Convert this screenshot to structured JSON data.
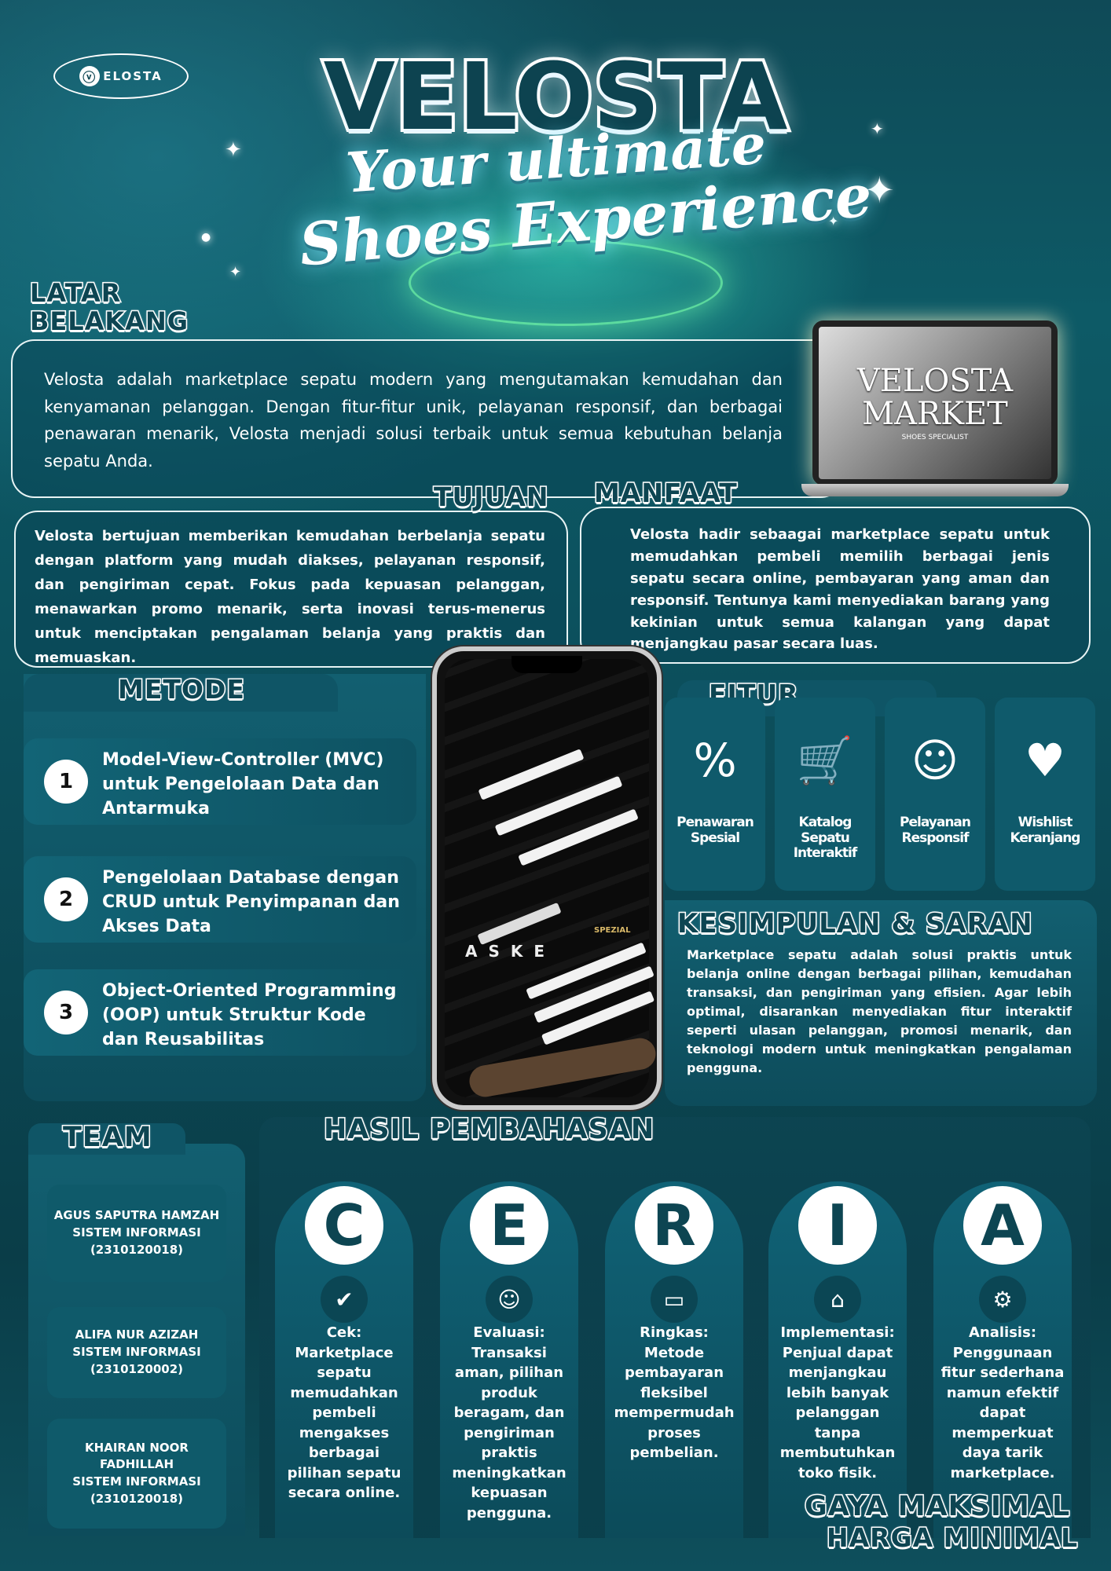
{
  "logo": {
    "icon": "footprint-icon",
    "text": "ELOSTA"
  },
  "hero": {
    "title": "VELOSTA",
    "line1": "Your ultimate",
    "line2": "Shoes Experience"
  },
  "latar": {
    "heading1": "LATAR",
    "heading2": "BELAKANG",
    "text": "Velosta adalah marketplace sepatu modern yang mengutamakan kemudahan dan kenyamanan pelanggan. Dengan fitur-fitur unik, pelayanan responsif, dan berbagai penawaran menarik, Velosta menjadi solusi terbaik untuk semua kebutuhan belanja sepatu Anda."
  },
  "laptop": {
    "screen_title": "VELOSTA MARKET",
    "screen_sub": "SHOES SPECIALIST"
  },
  "tujuan": {
    "heading": "TUJUAN",
    "text": "Velosta bertujuan memberikan kemudahan berbelanja sepatu dengan platform yang mudah diakses, pelayanan responsif, dan pengiriman cepat. Fokus pada kepuasan pelanggan, menawarkan promo menarik, serta inovasi terus-menerus untuk menciptakan pengalaman belanja yang praktis dan memuaskan."
  },
  "manfaat": {
    "heading": "MANFAAT",
    "text": "Velosta hadir sebaagai marketplace sepatu untuk memudahkan pembeli memilih berbagai jenis sepatu secara online, pembayaran yang aman dan responsif. Tentunya kami menyediakan barang yang kekinian untuk semua kalangan yang dapat menjangkau pasar secara luas."
  },
  "metode": {
    "heading": "METODE",
    "items": [
      {
        "num": "1",
        "text": "Model-View-Controller (MVC) untuk Pengelolaan Data dan Antarmuka"
      },
      {
        "num": "2",
        "text": "Pengelolaan Database dengan CRUD untuk Penyimpanan dan Akses Data"
      },
      {
        "num": "3",
        "text": "Object-Oriented Programming (OOP) untuk Struktur Kode dan Reusabilitas"
      }
    ]
  },
  "phone": {
    "shoe_text": "ASKE",
    "brand": "SPEZIAL"
  },
  "fitur": {
    "heading": "FITUR",
    "items": [
      {
        "icon": "deal-tag-icon",
        "label": "Penawaran Spesial"
      },
      {
        "icon": "catalog-cart-icon",
        "label": "Katalog Sepatu Interaktif"
      },
      {
        "icon": "service-hand-icon",
        "label": "Pelayanan Responsif"
      },
      {
        "icon": "wishlist-cart-icon",
        "label": "Wishlist Keranjang"
      }
    ]
  },
  "kesimpulan": {
    "heading": "KESIMPULAN & SARAN",
    "text": "Marketplace sepatu adalah solusi praktis untuk belanja online dengan berbagai pilihan, kemudahan transaksi, dan pengiriman yang efisien. Agar lebih optimal, disarankan menyediakan fitur interaktif seperti ulasan pelanggan, promosi menarik, dan teknologi modern untuk meningkatkan pengalaman pengguna."
  },
  "team": {
    "heading": "TEAM",
    "members": [
      {
        "name": "AGUS SAPUTRA HAMZAH",
        "prodi": "SISTEM INFORMASI",
        "nim": "(2310120018)"
      },
      {
        "name": "ALIFA NUR AZIZAH",
        "prodi": "SISTEM INFORMASI",
        "nim": "(2310120002)"
      },
      {
        "name": "KHAIRAN NOOR FADHILLAH",
        "prodi": "SISTEM INFORMASI",
        "nim": "(2310120018)"
      }
    ]
  },
  "hasil": {
    "heading": "HASIL PEMBAHASAN",
    "items": [
      {
        "letter": "C",
        "icon": "check-icon",
        "text": "Cek: Marketplace sepatu memudahkan pembeli mengakses berbagai pilihan sepatu secara online."
      },
      {
        "letter": "E",
        "icon": "customer-review-icon",
        "text": "Evaluasi: Transaksi aman, pilihan produk beragam, dan pengiriman praktis meningkatkan kepuasan pengguna."
      },
      {
        "letter": "R",
        "icon": "payment-card-icon",
        "text": "Ringkas: Metode pembayaran fleksibel mempermudah proses pembelian."
      },
      {
        "letter": "I",
        "icon": "store-icon",
        "text": "Implementasi: Penjual dapat menjangkau lebih banyak pelanggan tanpa membutuhkan toko fisik."
      },
      {
        "letter": "A",
        "icon": "user-gear-icon",
        "text": "Analisis: Penggunaan fitur sederhana namun efektif dapat memperkuat daya tarik marketplace."
      }
    ]
  },
  "slogan": {
    "line1": "GAYA MAKSIMAL",
    "line2": "HARGA MINIMAL"
  }
}
